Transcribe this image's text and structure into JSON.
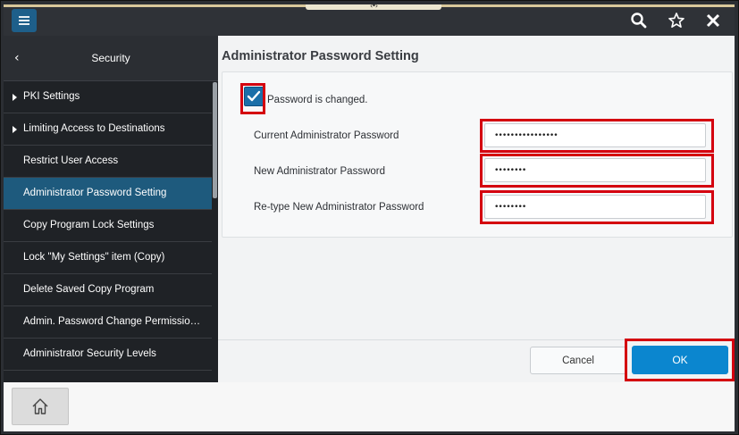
{
  "topbar": {
    "handle_text": "‹•›",
    "icons": [
      "menu-icon",
      "search-icon",
      "star-icon",
      "close-icon"
    ]
  },
  "sidebar": {
    "back_glyph": "‹",
    "title": "Security",
    "items": [
      {
        "label": "PKI Settings",
        "expandable": true
      },
      {
        "label": "Limiting Access to Destinations",
        "expandable": true
      },
      {
        "label": "Restrict User Access",
        "expandable": false
      },
      {
        "label": "Administrator Password Setting",
        "expandable": false,
        "active": true
      },
      {
        "label": "Copy Program Lock Settings",
        "expandable": false
      },
      {
        "label": "Lock \"My Settings\" item (Copy)",
        "expandable": false
      },
      {
        "label": "Delete Saved Copy Program",
        "expandable": false
      },
      {
        "label": "Admin. Password Change Permissio…",
        "expandable": false
      },
      {
        "label": "Administrator Security Levels",
        "expandable": false
      }
    ]
  },
  "main": {
    "title": "Administrator Password Setting",
    "checkbox": {
      "label": "Password is changed.",
      "checked": true
    },
    "fields": [
      {
        "label": "Current Administrator Password",
        "value": "••••••••••••••••"
      },
      {
        "label": "New Administrator Password",
        "value": "••••••••"
      },
      {
        "label": "Re-type New Administrator Password",
        "value": "••••••••"
      }
    ],
    "cancel_label": "Cancel",
    "ok_label": "OK"
  },
  "colors": {
    "accent": "#0b86cf",
    "active_item": "#1e5a7d",
    "highlight": "#d4000f",
    "dark_bg": "#2b2e33"
  }
}
